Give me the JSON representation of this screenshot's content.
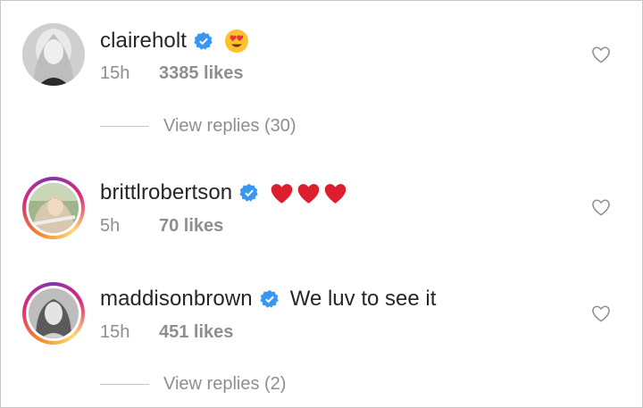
{
  "comments": [
    {
      "username": "claireholt",
      "verified": true,
      "text": "",
      "emoji": "heart-eyes",
      "time": "15h",
      "likes": "3385 likes",
      "replies": "View replies (30)",
      "avatar_ring": false
    },
    {
      "username": "brittlrobertson",
      "verified": true,
      "text": "",
      "emoji": "three-red-hearts",
      "time": "5h",
      "likes": "70 likes",
      "replies": "",
      "avatar_ring": true
    },
    {
      "username": "maddisonbrown",
      "verified": true,
      "text": "We luv to see it",
      "emoji": "",
      "time": "15h",
      "likes": "451 likes",
      "replies": "View replies (2)",
      "avatar_ring": true
    }
  ],
  "colors": {
    "verified_blue": "#3897f0",
    "text_primary": "#262626",
    "text_secondary": "#8e8e8e",
    "heart_red": "#ed2939"
  }
}
